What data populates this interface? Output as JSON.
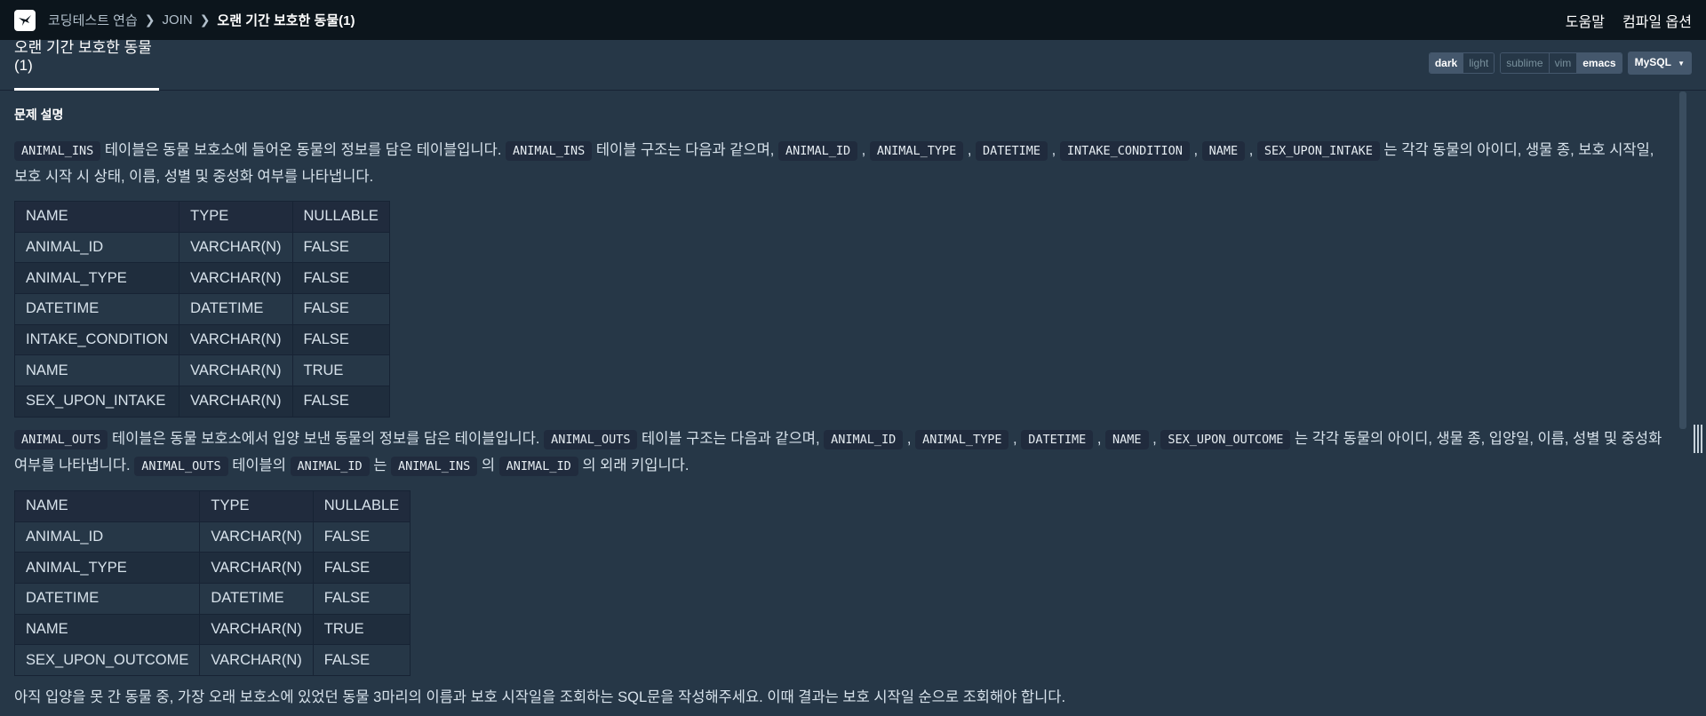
{
  "breadcrumb": {
    "items": [
      "코딩테스트 연습",
      "JOIN"
    ],
    "current": "오랜 기간 보호한 동물(1)"
  },
  "header": {
    "help_label": "도움말",
    "compile_options_label": "컴파일 옵션"
  },
  "tab": {
    "title": "오랜 기간 보호한 동물(1)"
  },
  "controls": {
    "theme": [
      "dark",
      "light"
    ],
    "theme_selected": "dark",
    "keymap": [
      "sublime",
      "vim",
      "emacs"
    ],
    "keymap_selected": "emacs",
    "language": "MySQL"
  },
  "problem": {
    "heading": "문제 설명",
    "p1": {
      "c1": "ANIMAL_INS",
      "t1": " 테이블은 동물 보호소에 들어온 동물의 정보를 담은 테이블입니다. ",
      "c2": "ANIMAL_INS",
      "t2": " 테이블 구조는 다음과 같으며, ",
      "c3": "ANIMAL_ID",
      "c4": "ANIMAL_TYPE",
      "c5": "DATETIME",
      "c6": "INTAKE_CONDITION",
      "c7": "NAME",
      "c8": "SEX_UPON_INTAKE",
      "t3": " 는 각각 동물의 아이디, 생물 종, 보호 시작일, 보호 시작 시 상태, 이름, 성별 및 중성화 여부를 나타냅니다."
    },
    "table1": {
      "headers": [
        "NAME",
        "TYPE",
        "NULLABLE"
      ],
      "rows": [
        [
          "ANIMAL_ID",
          "VARCHAR(N)",
          "FALSE"
        ],
        [
          "ANIMAL_TYPE",
          "VARCHAR(N)",
          "FALSE"
        ],
        [
          "DATETIME",
          "DATETIME",
          "FALSE"
        ],
        [
          "INTAKE_CONDITION",
          "VARCHAR(N)",
          "FALSE"
        ],
        [
          "NAME",
          "VARCHAR(N)",
          "TRUE"
        ],
        [
          "SEX_UPON_INTAKE",
          "VARCHAR(N)",
          "FALSE"
        ]
      ]
    },
    "p2": {
      "c1": "ANIMAL_OUTS",
      "t1": " 테이블은 동물 보호소에서 입양 보낸 동물의 정보를 담은 테이블입니다. ",
      "c2": "ANIMAL_OUTS",
      "t2": " 테이블 구조는 다음과 같으며, ",
      "c3": "ANIMAL_ID",
      "c4": "ANIMAL_TYPE",
      "c5": "DATETIME",
      "c6": "NAME",
      "c7": "SEX_UPON_OUTCOME",
      "t3": " 는 각각 동물의 아이디, 생물 종, 입양일, 이름, 성별 및 중성화 여부를 나타냅니다. ",
      "c8": "ANIMAL_OUTS",
      "t4": " 테이블의 ",
      "c9": "ANIMAL_ID",
      "t5": " 는 ",
      "c10": "ANIMAL_INS",
      "t6": " 의 ",
      "c11": "ANIMAL_ID",
      "t7": " 의 외래 키입니다."
    },
    "table2": {
      "headers": [
        "NAME",
        "TYPE",
        "NULLABLE"
      ],
      "rows": [
        [
          "ANIMAL_ID",
          "VARCHAR(N)",
          "FALSE"
        ],
        [
          "ANIMAL_TYPE",
          "VARCHAR(N)",
          "FALSE"
        ],
        [
          "DATETIME",
          "DATETIME",
          "FALSE"
        ],
        [
          "NAME",
          "VARCHAR(N)",
          "TRUE"
        ],
        [
          "SEX_UPON_OUTCOME",
          "VARCHAR(N)",
          "FALSE"
        ]
      ]
    },
    "p3": "아직 입양을 못 간 동물 중, 가장 오래 보호소에 있었던 동물 3마리의 이름과 보호 시작일을 조회하는 SQL문을 작성해주세요. 이때 결과는 보호 시작일 순으로 조회해야 합니다."
  }
}
